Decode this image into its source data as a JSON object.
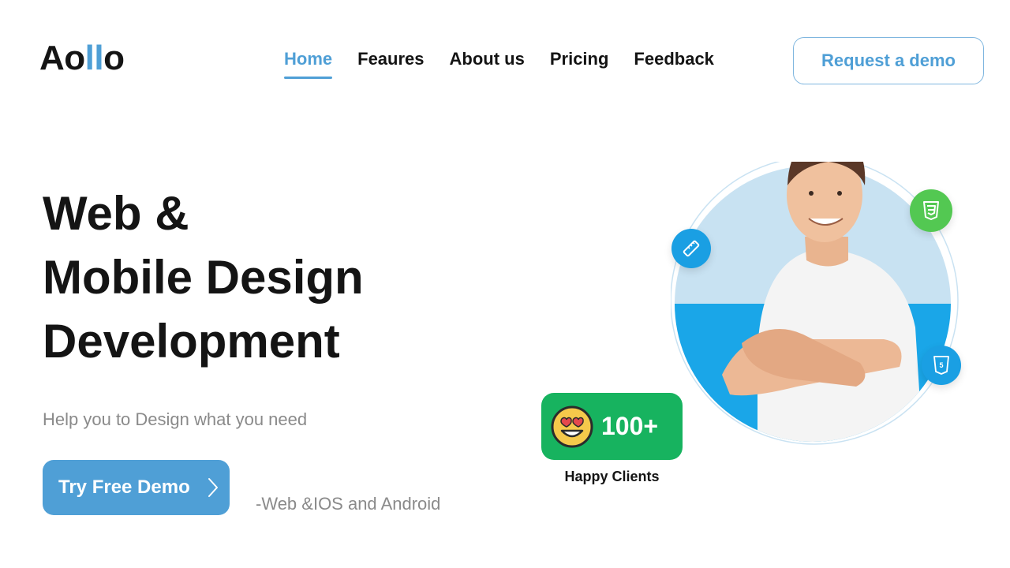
{
  "logo": {
    "part1": "Ao",
    "accent": "ll",
    "part2": "o"
  },
  "nav": {
    "items": [
      {
        "label": "Home"
      },
      {
        "label": "Feaures"
      },
      {
        "label": "About us"
      },
      {
        "label": "Pricing"
      },
      {
        "label": "Feedback"
      }
    ],
    "active": "Home"
  },
  "header": {
    "cta_label": "Request a demo"
  },
  "hero": {
    "title_lines": [
      "Web &",
      "Mobile Design",
      "Development"
    ],
    "subtitle": "Help you to Design what you need",
    "button_label": "Try Free Demo",
    "platforms": "-Web &IOS and Android"
  },
  "stats": {
    "count": "100+",
    "label": "Happy Clients"
  },
  "icons": {
    "ruler": "design-tool-icon",
    "css": "css3-icon",
    "html": "html5-icon",
    "emoji": "heart-eyes-emoji-icon",
    "button": "chevron-right-icon"
  },
  "colors": {
    "accent": "#4f9fd6",
    "text": "#141414",
    "muted": "#8a8a8a",
    "green": "#17b35f",
    "css_green": "#53c852",
    "icon_blue": "#1a9fe3"
  }
}
